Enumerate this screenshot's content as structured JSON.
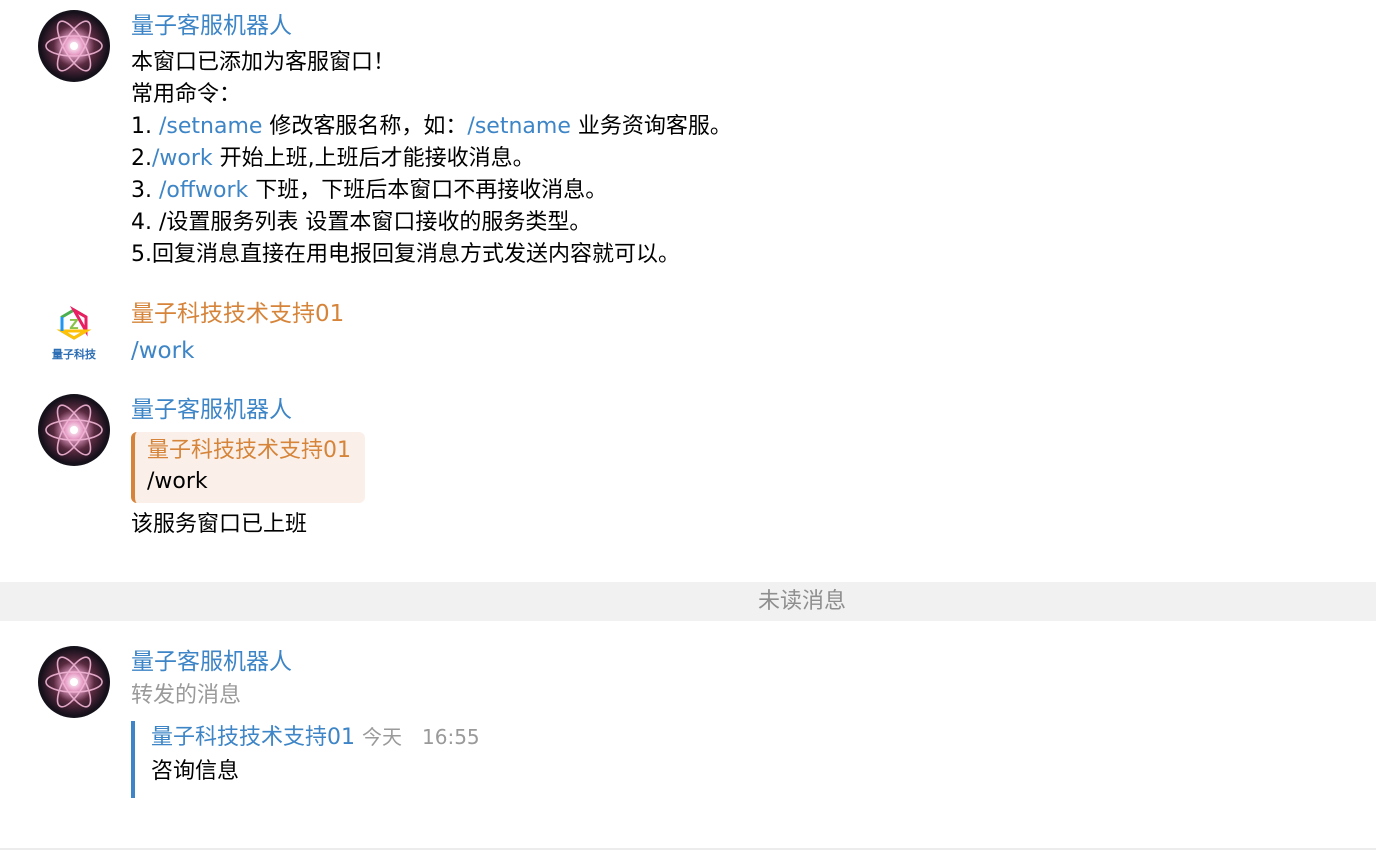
{
  "messages": {
    "m1": {
      "sender": "量子客服机器人",
      "avatar_icon": "atom-icon",
      "lines": {
        "l1": "本窗口已添加为客服窗口！",
        "l2": "常用命令：",
        "l3a": "1. ",
        "l3cmd": "/setname",
        "l3b": " 修改客服名称，如：",
        "l3cmd2": "/setname",
        "l3c": " 业务资询客服。",
        "l4a": "2.",
        "l4cmd": "/work",
        "l4b": " 开始上班,上班后才能接收消息。",
        "l5a": "3. ",
        "l5cmd": "/offwork",
        "l5b": " 下班，下班后本窗口不再接收消息。",
        "l6": "4. /设置服务列表 设置本窗口接收的服务类型。",
        "l7": "5.回复消息直接在用电报回复消息方式发送内容就可以。"
      }
    },
    "m2": {
      "sender": "量子科技技术支持01",
      "avatar_icon": "quantum-tech-logo-icon",
      "logo_text": "量子科技",
      "text": "/work"
    },
    "m3": {
      "sender": "量子客服机器人",
      "avatar_icon": "atom-icon",
      "reply_to": {
        "name": "量子科技技术支持01",
        "text": "/work"
      },
      "text": "该服务窗口已上班"
    },
    "divider": "未读消息",
    "m4": {
      "sender": "量子客服机器人",
      "avatar_icon": "atom-icon",
      "forward_note": "转发的消息",
      "forwarded": {
        "name": "量子科技技术支持01",
        "date": "今天",
        "time": "16:55",
        "text": "咨询信息"
      }
    }
  },
  "colors": {
    "link_blue": "#3d85c6",
    "accent_orange": "#d6843a",
    "reply_bg": "#fbf0e9",
    "muted_gray": "#9a9a9a",
    "divider_bg": "#f1f1f1"
  }
}
